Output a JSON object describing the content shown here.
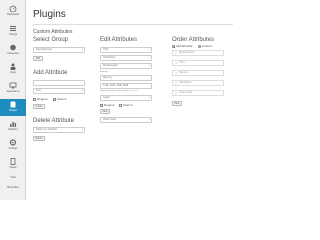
{
  "sidebar": {
    "items": [
      {
        "label": "Dashboard",
        "icon": "dashboard-icon"
      },
      {
        "label": "Listings",
        "icon": "listings-icon"
      },
      {
        "label": "Categories",
        "icon": "categories-icon"
      },
      {
        "label": "Users",
        "icon": "users-icon"
      },
      {
        "label": "Appearance",
        "icon": "appearance-icon"
      },
      {
        "label": "Plugins",
        "icon": "plugins-icon"
      },
      {
        "label": "Statistics",
        "icon": "statistics-icon"
      },
      {
        "label": "Settings",
        "icon": "settings-icon"
      },
      {
        "label": "Pages",
        "icon": "pages-icon"
      },
      {
        "label": "Tools",
        "icon": "tools-icon"
      },
      {
        "label": "Show More",
        "icon": ""
      }
    ],
    "active_index": 5
  },
  "header": {
    "title": "Plugins",
    "section": "Custom Attributes"
  },
  "select_group": {
    "title": "Select Group",
    "value": "Specifications",
    "edit_label": "Edit"
  },
  "add_attribute": {
    "title": "Add Attribute",
    "name_value": "",
    "type_value": "Text",
    "required_label": "Require",
    "search_label": "Search",
    "create_label": "Create"
  },
  "delete_attribute": {
    "title": "Delete Attribute",
    "select_value": "Select an attribute",
    "delete_label": "Delete"
  },
  "edit_attributes": {
    "title": "Edit Attributes",
    "selects": [
      "CPU",
      "Hard Drive",
      "Motherboard"
    ],
    "memory_label": "Memory",
    "memory_input": "Memory",
    "values_input": "1GB, 2GB, 4GB, 8GB",
    "hint": "Separate values with commas (a, b, c)",
    "type_select": "Select",
    "required_label": "Require",
    "search_label": "Search",
    "save_label": "Save",
    "video_card": "Video Card"
  },
  "order_attributes": {
    "title": "Order Attributes",
    "alphabetical_label": "Alphabetical",
    "custom_label": "Custom",
    "items": [
      "Motherboard",
      "CPU",
      "Memory",
      "Hard Drive",
      "Video Card"
    ],
    "save_label": "Save"
  },
  "colors": {
    "accent": "#1e8cbe",
    "sidebar_bg": "#f0f0f0"
  }
}
